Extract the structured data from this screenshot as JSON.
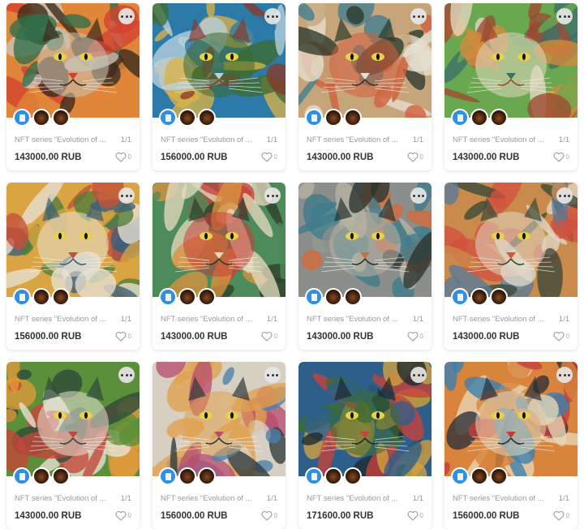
{
  "cards": [
    {
      "title": "NFT series \"Evolution of ...",
      "edition": "1/1",
      "price": "143000.00 RUB",
      "likes": "0",
      "palette": [
        "#e0863a",
        "#2f6f4b",
        "#c9c4b8",
        "#d4432f",
        "#3a2a1e"
      ]
    },
    {
      "title": "NFT series \"Evolution of ...",
      "edition": "1/1",
      "price": "156000.00 RUB",
      "likes": "0",
      "palette": [
        "#2b7aa8",
        "#d9b24a",
        "#3e6b2f",
        "#b8d0dc",
        "#8a3a2c"
      ]
    },
    {
      "title": "NFT series \"Evolution of ...",
      "edition": "1/1",
      "price": "143000.00 RUB",
      "likes": "0",
      "palette": [
        "#c7a57a",
        "#3f7f8f",
        "#d15f3c",
        "#e6e0cf",
        "#2c3a2c"
      ]
    },
    {
      "title": "NFT series \"Evolution of ...",
      "edition": "1/1",
      "price": "143000.00 RUB",
      "likes": "0",
      "palette": [
        "#6aa84f",
        "#d38b3e",
        "#e4d8c3",
        "#3b6f6a",
        "#9c4a32"
      ]
    },
    {
      "title": "NFT series \"Evolution of ...",
      "edition": "1/1",
      "price": "156000.00 RUB",
      "likes": "0",
      "palette": [
        "#d9a441",
        "#4f7c3a",
        "#e8e2d4",
        "#c3503b",
        "#3c5f7a"
      ]
    },
    {
      "title": "NFT series \"Evolution of ...",
      "edition": "1/1",
      "price": "143000.00 RUB",
      "likes": "0",
      "palette": [
        "#4d8b5a",
        "#d9923d",
        "#c7413a",
        "#e3d9bd",
        "#2c3f2a"
      ]
    },
    {
      "title": "NFT series \"Evolution of ...",
      "edition": "1/1",
      "price": "143000.00 RUB",
      "likes": "0",
      "palette": [
        "#8a8f8c",
        "#3d7c8a",
        "#b9b3a3",
        "#d36a3a",
        "#2a3330"
      ]
    },
    {
      "title": "NFT series \"Evolution of ...",
      "edition": "1/1",
      "price": "143000.00 RUB",
      "likes": "0",
      "palette": [
        "#c98b4b",
        "#5a7a9a",
        "#e0d7c5",
        "#d4523e",
        "#3a4a3a"
      ]
    },
    {
      "title": "NFT series \"Evolution of ...",
      "edition": "1/1",
      "price": "143000.00 RUB",
      "likes": "0",
      "palette": [
        "#5c8f3a",
        "#e09a3b",
        "#e8e4d8",
        "#c6463a",
        "#2d4a3a"
      ]
    },
    {
      "title": "NFT series \"Evolution of ...",
      "edition": "1/1",
      "price": "156000.00 RUB",
      "likes": "0",
      "palette": [
        "#d7cfc2",
        "#4a7faa",
        "#e0a24e",
        "#b84e6e",
        "#2f3a3a"
      ]
    },
    {
      "title": "NFT series \"Evolution of ...",
      "edition": "1/1",
      "price": "171600.00 RUB",
      "likes": "0",
      "palette": [
        "#2e5f8a",
        "#d4a23f",
        "#3d6b35",
        "#c7403a",
        "#1e2a2e"
      ]
    },
    {
      "title": "NFT series \"Evolution of ...",
      "edition": "1/1",
      "price": "156000.00 RUB",
      "likes": "0",
      "palette": [
        "#d9843c",
        "#3a7fb0",
        "#e6d7b8",
        "#c43e38",
        "#2b2f3a"
      ]
    }
  ],
  "icons": {
    "more": "more-options-icon",
    "collection": "collection-cube-icon",
    "heart": "heart-icon"
  },
  "colors": {
    "price_text": "#333333",
    "muted_text": "#9a9a9a",
    "accent_blue": "#2f8fe3"
  }
}
